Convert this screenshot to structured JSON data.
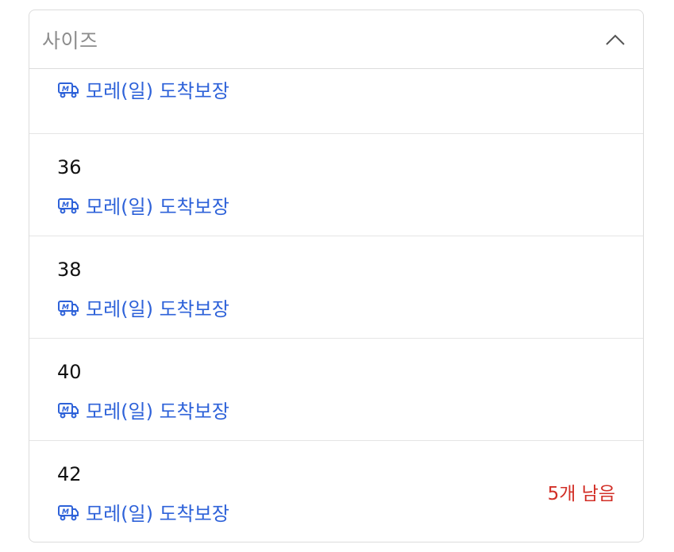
{
  "dropdown": {
    "label": "사이즈",
    "chevron_icon": "chevron-up-icon"
  },
  "options": [
    {
      "size": "",
      "delivery": "모레(일) 도착보장",
      "stock": ""
    },
    {
      "size": "36",
      "delivery": "모레(일) 도착보장",
      "stock": ""
    },
    {
      "size": "38",
      "delivery": "모레(일) 도착보장",
      "stock": ""
    },
    {
      "size": "40",
      "delivery": "모레(일) 도착보장",
      "stock": ""
    },
    {
      "size": "42",
      "delivery": "모레(일) 도착보장",
      "stock": "5개 남음"
    }
  ],
  "colors": {
    "delivery_blue": "#2e62d9",
    "stock_red": "#d22f27",
    "border": "#dcdcdc"
  }
}
